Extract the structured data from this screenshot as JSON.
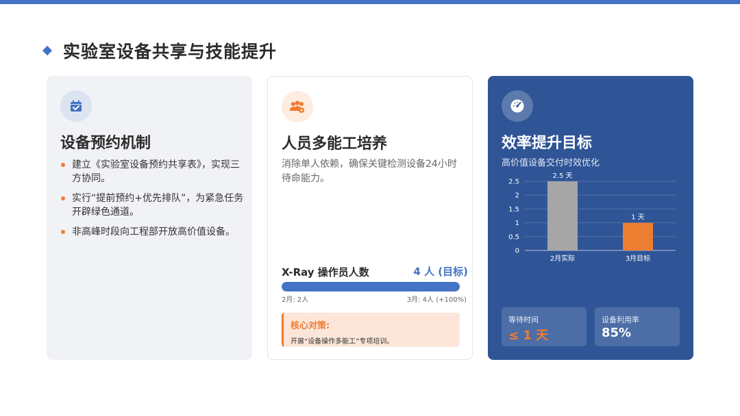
{
  "page": {
    "title": "实验室设备共享与技能提升"
  },
  "cards": [
    {
      "icon": "calendar-check-icon",
      "heading": "设备预约机制",
      "bullets": [
        "建立《实验室设备预约共享表》，实现三方协同。",
        "实行“提前预约+优先排队”，为紧急任务开辟绿色通道。",
        "非高峰时段向工程部开放高价值设备。"
      ]
    },
    {
      "icon": "users-gear-icon",
      "heading": "人员多能工培养",
      "description": "消除单人依赖，确保关键检测设备24小时待命能力。",
      "progress": {
        "label": "X-Ray 操作员人数",
        "value": "4 人 (目标)",
        "fill_fraction": 1.0,
        "left_text": "2月: 2人",
        "right_text": "3月: 4人 (+100%)"
      },
      "strategy": {
        "title": "核心对策:",
        "text": "开展“设备操作多能工”专项培训。"
      }
    },
    {
      "icon": "gauge-icon",
      "heading": "效率提升目标",
      "subtitle": "高价值设备交付时效优化",
      "stats": [
        {
          "label": "等待时间",
          "value": "≤ 1 天"
        },
        {
          "label": "设备利用率",
          "value": "85%"
        }
      ]
    }
  ],
  "chart_data": {
    "type": "bar",
    "categories": [
      "2月实际",
      "3月目标"
    ],
    "values": [
      2.5,
      1
    ],
    "data_labels": [
      "2.5 天",
      "1 天"
    ],
    "bar_colors": [
      "#a6a6a6",
      "#ed7d31"
    ],
    "yticks": [
      0,
      0.5,
      1,
      1.5,
      2,
      2.5
    ],
    "ylim": [
      0,
      2.5
    ],
    "grid": true,
    "title": "",
    "xlabel": "",
    "ylabel": ""
  },
  "colors": {
    "accent": "#4472c4",
    "orange": "#ed7d31",
    "dark_blue": "#2f5597",
    "gray": "#a6a6a6"
  }
}
